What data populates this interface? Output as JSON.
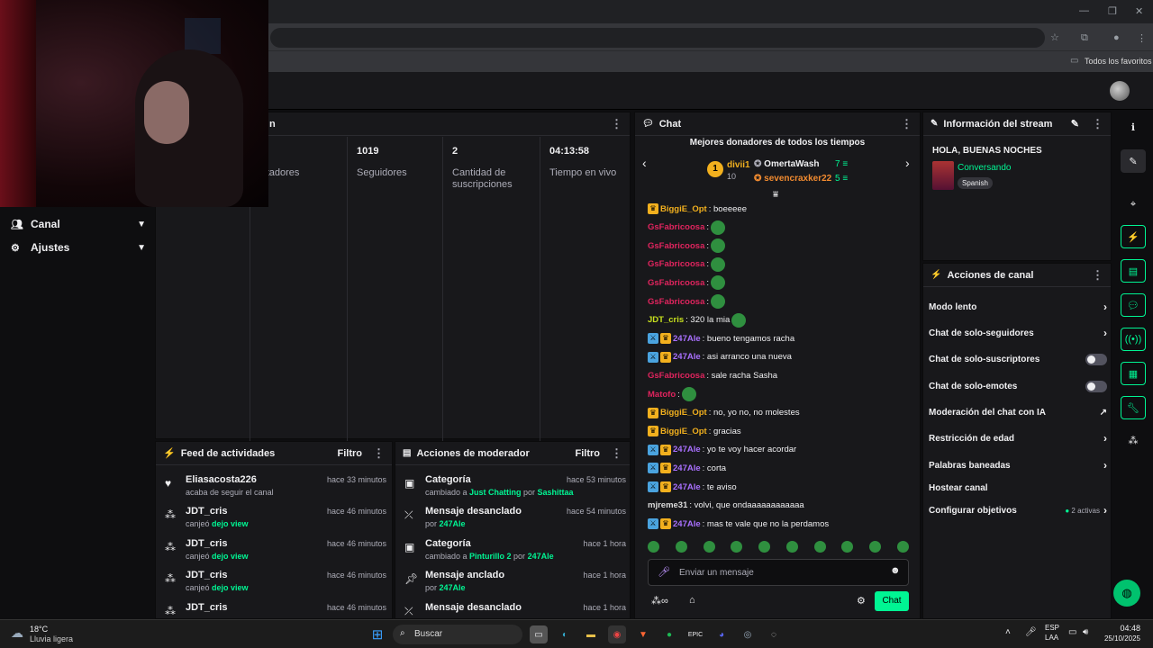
{
  "browser": {
    "bookmarks_label": "Todos los favoritos"
  },
  "sidebar": {
    "items": [
      {
        "label": "Canal"
      },
      {
        "label": "Ajustes"
      }
    ]
  },
  "stats_panel": {
    "partial_title": "n",
    "stats": [
      {
        "value": "",
        "label": "pectadores"
      },
      {
        "value": "1019",
        "label": "Seguidores"
      },
      {
        "value": "2",
        "label": "Cantidad de suscripciones"
      },
      {
        "value": "04:13:58",
        "label": "Tiempo en vivo"
      }
    ]
  },
  "activity_feed": {
    "title": "Feed de actividades",
    "filter_label": "Filtro",
    "items": [
      {
        "icon": "heart-icon",
        "title": "Eliasacosta226",
        "pre": "acaba de seguir el canal",
        "highlight": "",
        "time": "hace 33 minutos"
      },
      {
        "icon": "points-icon",
        "title": "JDT_cris",
        "pre": "canjeó ",
        "highlight": "dejo view",
        "time": "hace 46 minutos"
      },
      {
        "icon": "points-icon",
        "title": "JDT_cris",
        "pre": "canjeó ",
        "highlight": "dejo view",
        "time": "hace 46 minutos"
      },
      {
        "icon": "points-icon",
        "title": "JDT_cris",
        "pre": "canjeó ",
        "highlight": "dejo view",
        "time": "hace 46 minutos"
      },
      {
        "icon": "points-icon",
        "title": "JDT_cris",
        "pre": "",
        "highlight": "",
        "time": "hace 46 minutos"
      }
    ]
  },
  "mod_actions": {
    "title": "Acciones de moderador",
    "filter_label": "Filtro",
    "items": [
      {
        "icon": "category-icon",
        "title": "Categoría",
        "pre": "cambiado a ",
        "hl1": "Just Chatting",
        "mid": " por ",
        "hl2": "Sashittaa",
        "time": "hace 53 minutos"
      },
      {
        "icon": "unpin-icon",
        "title": "Mensaje desanclado",
        "pre": "por ",
        "hl1": "247Ale",
        "mid": "",
        "hl2": "",
        "time": "hace 54 minutos"
      },
      {
        "icon": "category-icon",
        "title": "Categoría",
        "pre": "cambiado a ",
        "hl1": "Pinturillo 2",
        "mid": " por ",
        "hl2": "247Ale",
        "time": "hace 1 hora"
      },
      {
        "icon": "pin-icon",
        "title": "Mensaje anclado",
        "pre": "por ",
        "hl1": "247Ale",
        "mid": "",
        "hl2": "",
        "time": "hace 1 hora"
      },
      {
        "icon": "unpin-icon",
        "title": "Mensaje desanclado",
        "pre": "",
        "hl1": "",
        "mid": "",
        "hl2": "",
        "time": "hace 1 hora"
      }
    ]
  },
  "chat": {
    "title": "Chat",
    "donors_title": "Mejores donadores de todos los tiempos",
    "donors": [
      {
        "rank": "1",
        "name": "divii1",
        "amount": "10"
      },
      {
        "name": "OmertaWash",
        "amount": "7"
      },
      {
        "name": "sevencraxker22",
        "amount": "5"
      }
    ],
    "messages": [
      {
        "badges": [
          "crown"
        ],
        "user": "BiggiE_Opt",
        "color": "gold",
        "text": ": boeeeee",
        "emote": false
      },
      {
        "badges": [],
        "user": "GsFabricoosa",
        "color": "red",
        "text": ":",
        "emote": true
      },
      {
        "badges": [],
        "user": "GsFabricoosa",
        "color": "red",
        "text": ":",
        "emote": true
      },
      {
        "badges": [],
        "user": "GsFabricoosa",
        "color": "red",
        "text": ":",
        "emote": true
      },
      {
        "badges": [],
        "user": "GsFabricoosa",
        "color": "red",
        "text": ":",
        "emote": true
      },
      {
        "badges": [],
        "user": "GsFabricoosa",
        "color": "red",
        "text": ":",
        "emote": true
      },
      {
        "badges": [],
        "user": "JDT_cris",
        "color": "lime",
        "text": ": 320 la mia",
        "emote": true
      },
      {
        "badges": [
          "mod",
          "crown"
        ],
        "user": "247Ale",
        "color": "purp",
        "text": ": bueno tengamos racha",
        "emote": false
      },
      {
        "badges": [
          "mod",
          "crown"
        ],
        "user": "247Ale",
        "color": "purp",
        "text": ": asi arranco una nueva",
        "emote": false
      },
      {
        "badges": [],
        "user": "GsFabricoosa",
        "color": "red",
        "text": ": sale racha Sasha",
        "emote": false
      },
      {
        "badges": [],
        "user": "Matofo",
        "color": "red",
        "text": ":",
        "emote": true
      },
      {
        "badges": [
          "crown"
        ],
        "user": "BiggiE_Opt",
        "color": "gold",
        "text": ": no, yo no, no molestes",
        "emote": false
      },
      {
        "badges": [
          "crown"
        ],
        "user": "BiggiE_Opt",
        "color": "gold",
        "text": ": gracias",
        "emote": false
      },
      {
        "badges": [
          "mod",
          "crown"
        ],
        "user": "247Ale",
        "color": "purp",
        "text": ": yo te voy hacer acordar",
        "emote": false
      },
      {
        "badges": [
          "mod",
          "crown"
        ],
        "user": "247Ale",
        "color": "purp",
        "text": ": corta",
        "emote": false
      },
      {
        "badges": [
          "mod",
          "crown"
        ],
        "user": "247Ale",
        "color": "purp",
        "text": ": te aviso",
        "emote": false
      },
      {
        "badges": [],
        "user": "mjreme31",
        "color": "gray",
        "text": ": volvi, que ondaaaaaaaaaaaa",
        "emote": false
      },
      {
        "badges": [
          "mod",
          "crown"
        ],
        "user": "247Ale",
        "color": "purp",
        "text": ": mas te vale que no la perdamos",
        "emote": false
      }
    ],
    "input_placeholder": "Enviar un mensaje",
    "send_label": "Chat"
  },
  "stream_info": {
    "title": "Información del stream",
    "stream_title": "HOLA, BUENAS NOCHES",
    "category": "Conversando",
    "language": "Spanish"
  },
  "channel_actions": {
    "title": "Acciones de canal",
    "items": [
      {
        "label": "Modo lento",
        "control": "chevron"
      },
      {
        "label": "Chat de solo-seguidores",
        "control": "chevron"
      },
      {
        "label": "Chat de solo-suscriptores",
        "control": "toggle"
      },
      {
        "label": "Chat de solo-emotes",
        "control": "toggle"
      },
      {
        "label": "Moderación del chat con IA",
        "control": "graph"
      },
      {
        "label": "Restricción de edad",
        "control": "chevron"
      },
      {
        "label": "Palabras baneadas",
        "control": "chevron"
      },
      {
        "label": "Hostear canal",
        "control": "none"
      },
      {
        "label": "Configurar objetivos",
        "control": "goals"
      }
    ],
    "goals_status": "2 activas"
  },
  "taskbar": {
    "weather_temp": "18°C",
    "weather_desc": "Lluvia ligera",
    "search_label": "Buscar",
    "lang": "ESP",
    "lang_sub": "LAA",
    "time": "04:48",
    "date": "25/10/2025"
  },
  "colors": {
    "accent": "#00f593",
    "bg": "#0e0e10",
    "panel": "#18181b",
    "purple": "#a970ff",
    "gold": "#f2b01e"
  }
}
